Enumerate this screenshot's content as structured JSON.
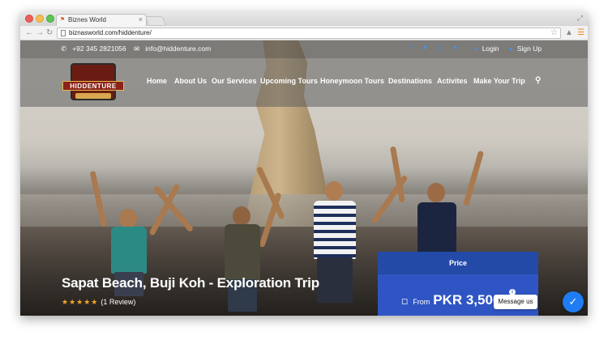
{
  "browser": {
    "tab_title": "Biznes World",
    "url": "biznasworld.com/hiddenture/"
  },
  "topbar": {
    "phone": "+92 345 2821056",
    "email": "info@hiddenture.com",
    "social_icons": [
      "facebook-icon",
      "linkedin-icon",
      "instagram-icon",
      "pinterest-icon"
    ],
    "login": "Login",
    "signup": "Sign Up"
  },
  "logo": {
    "text": "HIDDENTURE"
  },
  "nav": {
    "items": [
      "Home",
      "About Us",
      "Our Services",
      "Upcoming Tours",
      "Honeymoon Tours",
      "Destinations",
      "Activites",
      "Make Your Trip"
    ]
  },
  "trip": {
    "title": "Sapat Beach, Buji Koh - Exploration Trip",
    "rating": 5,
    "review_text": "(1 Review)"
  },
  "price": {
    "header": "Price",
    "from": "From",
    "value": "PKR 3,500"
  },
  "chat": {
    "label": "Message us"
  },
  "colors": {
    "price_box": "#2f55c4",
    "star": "#f5a623",
    "social": "#4a90e2",
    "messenger": "#1f7cf2"
  }
}
